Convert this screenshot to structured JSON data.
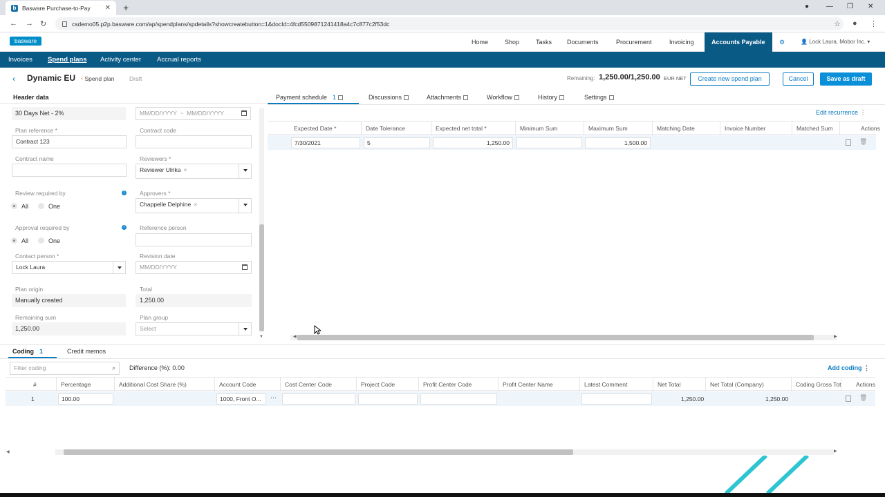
{
  "browser": {
    "tab_title": "Basware Purchase-to-Pay",
    "url": "csdemo05.p2p.basware.com/ap/spendplans/spdetails?showcreatebutton=1&docId=4fcd5509871241418a4c7c877c2f53dc"
  },
  "topnav": {
    "logo": "basware",
    "items": [
      "Home",
      "Shop",
      "Tasks",
      "Documents",
      "Procurement",
      "Invoicing",
      "Accounts Payable"
    ],
    "user": "Lock Laura, Mobor Inc."
  },
  "subnav": {
    "items": [
      "Invoices",
      "Spend plans",
      "Activity center",
      "Accrual reports"
    ]
  },
  "title": {
    "name": "Dynamic EU",
    "type": "Spend plan",
    "status": "Draft",
    "remaining_label": "Remaining:",
    "remaining_value": "1,250.00/1,250.00",
    "remaining_unit": "EUR NET",
    "create_btn": "Create new spend plan",
    "cancel_btn": "Cancel",
    "save_btn": "Save as draft"
  },
  "header": {
    "title": "Header data",
    "payment_term": "30 Days Net - 2%",
    "date_from_ph": "MM/DD/YYYY",
    "date_sep": "~",
    "date_to_ph": "MM/DD/YYYY",
    "plan_ref_label": "Plan reference *",
    "plan_ref": "Contract 123",
    "contract_code_label": "Contract code",
    "contract_name_label": "Contract name",
    "reviewers_label": "Reviewers *",
    "reviewer": "Reviewer Ulrika",
    "review_req_label": "Review required by",
    "approvers_label": "Approvers *",
    "approver": "Chappelle Delphine",
    "opt_all": "All",
    "opt_one": "One",
    "approval_req_label": "Approval required by",
    "ref_person_label": "Reference person",
    "contact_label": "Contact person *",
    "contact": "Lock Laura",
    "revision_label": "Revision date",
    "revision_ph": "MM/DD/YYYY",
    "origin_label": "Plan origin",
    "origin": "Manually created",
    "total_label": "Total",
    "total": "1,250.00",
    "remaining_label": "Remaining sum",
    "remaining": "1,250.00",
    "group_label": "Plan group",
    "group_ph": "Select"
  },
  "tabs": {
    "payment": "Payment schedule",
    "payment_count": "1",
    "discussions": "Discussions",
    "attachments": "Attachments",
    "workflow": "Workflow",
    "history": "History",
    "settings": "Settings"
  },
  "schedule": {
    "edit_recurrence": "Edit recurrence",
    "columns": [
      "Expected Date *",
      "Date Tolerance",
      "Expected net total *",
      "Minimum Sum",
      "Maximum Sum",
      "Matching Date",
      "Invoice Number",
      "Matched Sum",
      "Actions"
    ],
    "row": {
      "date": "7/30/2021",
      "tolerance": "5",
      "net_total": "1,250.00",
      "min": "",
      "max": "1,500.00"
    }
  },
  "coding": {
    "tab": "Coding",
    "count": "1",
    "credit_tab": "Credit memos",
    "filter_ph": "Filter coding",
    "difference": "Difference (%): 0.00",
    "add": "Add coding",
    "columns": [
      "#",
      "Percentage",
      "Additional Cost Share (%)",
      "Account Code",
      "Cost Center Code",
      "Project Code",
      "Profit Center Code",
      "Profit Center Name",
      "Latest Comment",
      "Net Total",
      "Net Total (Company)",
      "Coding Gross Tot",
      "Actions"
    ],
    "row": {
      "num": "1",
      "percentage": "100.00",
      "account": "1000, Front O...",
      "net_total": "1,250.00",
      "net_company": "1,250.00"
    }
  },
  "colors": {
    "accent": "#0a5a86",
    "primary": "#0a8fd9",
    "stripe": "#2ec5d3"
  }
}
